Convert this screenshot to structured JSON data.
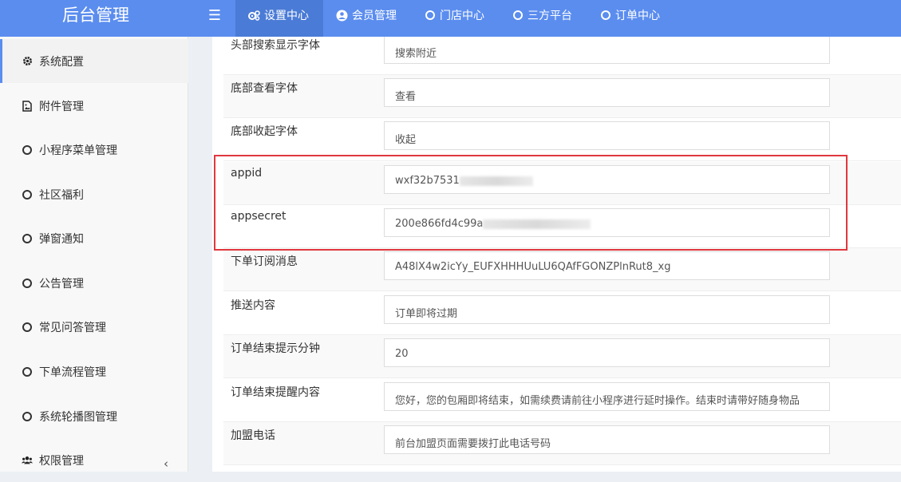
{
  "app": {
    "title": "后台管理"
  },
  "topnav": [
    {
      "label": "设置中心",
      "icon": "gears-icon",
      "active": true
    },
    {
      "label": "会员管理",
      "icon": "user-circle-icon",
      "active": false
    },
    {
      "label": "门店中心",
      "icon": "circle-icon",
      "active": false
    },
    {
      "label": "三方平台",
      "icon": "circle-icon",
      "active": false
    },
    {
      "label": "订单中心",
      "icon": "circle-icon",
      "active": false
    }
  ],
  "sidebar": {
    "items": [
      {
        "label": "系统配置",
        "icon": "gear-icon",
        "active": true
      },
      {
        "label": "附件管理",
        "icon": "image-file-icon",
        "active": false
      },
      {
        "label": "小程序菜单管理",
        "icon": "circle-icon",
        "active": false
      },
      {
        "label": "社区福利",
        "icon": "circle-icon",
        "active": false
      },
      {
        "label": "弹窗通知",
        "icon": "circle-icon",
        "active": false
      },
      {
        "label": "公告管理",
        "icon": "circle-icon",
        "active": false
      },
      {
        "label": "常见问答管理",
        "icon": "circle-icon",
        "active": false
      },
      {
        "label": "下单流程管理",
        "icon": "circle-icon",
        "active": false
      },
      {
        "label": "系统轮播图管理",
        "icon": "circle-icon",
        "active": false
      },
      {
        "label": "权限管理",
        "icon": "users-icon",
        "active": false
      }
    ],
    "collapse_glyph": "‹"
  },
  "form": {
    "rows": [
      {
        "label": "头部搜索显示字体",
        "value": "搜索附近"
      },
      {
        "label": "底部查看字体",
        "value": "查看"
      },
      {
        "label": "底部收起字体",
        "value": "收起"
      },
      {
        "label": "appid",
        "value": "wxf32b7531"
      },
      {
        "label": "appsecret",
        "value": "200e866fd4c99a"
      },
      {
        "label": "下单订阅消息",
        "value": "A48lX4w2icYy_EUFXHHHUuLU6QAfFGONZPlnRut8_xg"
      },
      {
        "label": "推送内容",
        "value": "订单即将过期"
      },
      {
        "label": "订单结束提示分钟",
        "value": "20"
      },
      {
        "label": "订单结束提醒内容",
        "value": "您好，您的包厢即将结束，如需续费请前往小程序进行延时操作。结束时请带好随身物品"
      },
      {
        "label": "加盟电话",
        "value": "前台加盟页面需要拨打此电话号码"
      }
    ]
  },
  "colors": {
    "topbar": "#5b8def",
    "highlight_border": "#e0383e"
  }
}
